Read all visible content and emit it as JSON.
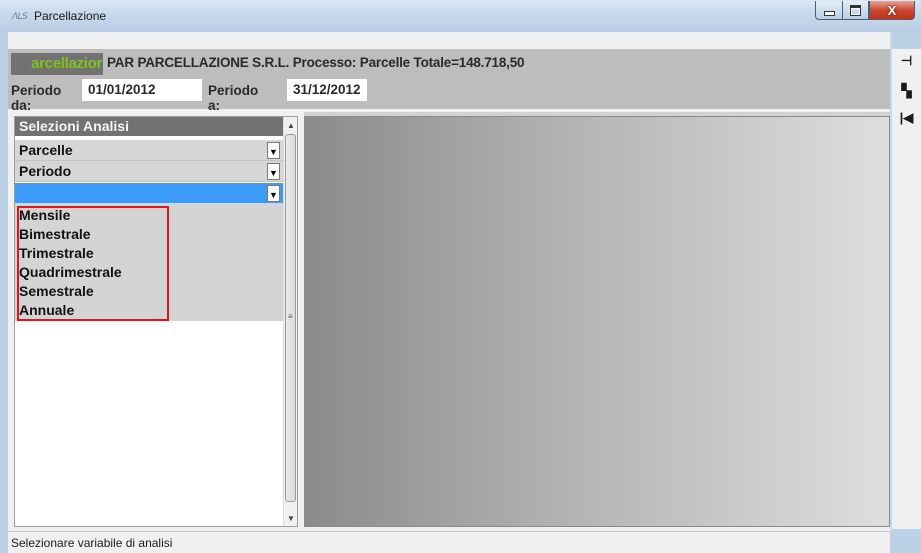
{
  "window": {
    "title": "Parcellazione",
    "app_icon_text": "ΛLS"
  },
  "header": {
    "process_badge": "arcellazior",
    "company_line": "PAR PARCELLAZIONE S.R.L.  Processo: Parcelle Totale=148.718,50",
    "period_from_label": "Periodo da:",
    "period_from_value": "01/01/2012",
    "period_to_label": "Periodo a:",
    "period_to_value": "31/12/2012"
  },
  "left_panel": {
    "title": "Selezioni Analisi",
    "combos": [
      {
        "value": "Parcelle"
      },
      {
        "value": "Periodo"
      },
      {
        "value": ""
      }
    ],
    "options": [
      "Mensile",
      "Bimestrale",
      "Trimestrale",
      "Quadrimestrale",
      "Semestrale",
      "Annuale"
    ]
  },
  "toolbar_icons": [
    "pin-icon",
    "export-icon",
    "collapse-icon"
  ],
  "status_bar": {
    "text": "Selezionare variabile di analisi"
  },
  "colors": {
    "badge_text": "#7ec31a",
    "selection": "#3c9bf7",
    "highlight_frame": "#e0131e"
  }
}
